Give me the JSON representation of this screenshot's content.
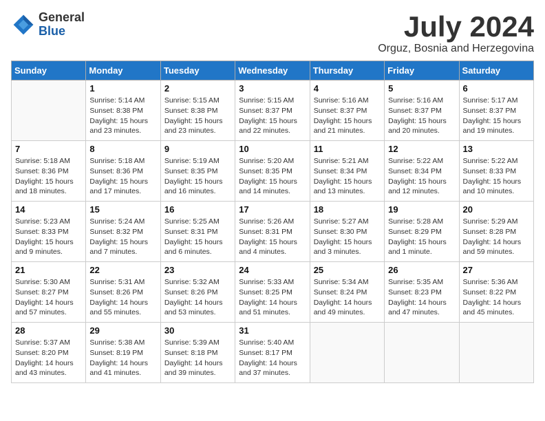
{
  "header": {
    "logo_general": "General",
    "logo_blue": "Blue",
    "month_title": "July 2024",
    "location": "Orguz, Bosnia and Herzegovina"
  },
  "days_of_week": [
    "Sunday",
    "Monday",
    "Tuesday",
    "Wednesday",
    "Thursday",
    "Friday",
    "Saturday"
  ],
  "weeks": [
    [
      {
        "day": "",
        "info": ""
      },
      {
        "day": "1",
        "info": "Sunrise: 5:14 AM\nSunset: 8:38 PM\nDaylight: 15 hours and 23 minutes."
      },
      {
        "day": "2",
        "info": "Sunrise: 5:15 AM\nSunset: 8:38 PM\nDaylight: 15 hours and 23 minutes."
      },
      {
        "day": "3",
        "info": "Sunrise: 5:15 AM\nSunset: 8:37 PM\nDaylight: 15 hours and 22 minutes."
      },
      {
        "day": "4",
        "info": "Sunrise: 5:16 AM\nSunset: 8:37 PM\nDaylight: 15 hours and 21 minutes."
      },
      {
        "day": "5",
        "info": "Sunrise: 5:16 AM\nSunset: 8:37 PM\nDaylight: 15 hours and 20 minutes."
      },
      {
        "day": "6",
        "info": "Sunrise: 5:17 AM\nSunset: 8:37 PM\nDaylight: 15 hours and 19 minutes."
      }
    ],
    [
      {
        "day": "7",
        "info": "Sunrise: 5:18 AM\nSunset: 8:36 PM\nDaylight: 15 hours and 18 minutes."
      },
      {
        "day": "8",
        "info": "Sunrise: 5:18 AM\nSunset: 8:36 PM\nDaylight: 15 hours and 17 minutes."
      },
      {
        "day": "9",
        "info": "Sunrise: 5:19 AM\nSunset: 8:35 PM\nDaylight: 15 hours and 16 minutes."
      },
      {
        "day": "10",
        "info": "Sunrise: 5:20 AM\nSunset: 8:35 PM\nDaylight: 15 hours and 14 minutes."
      },
      {
        "day": "11",
        "info": "Sunrise: 5:21 AM\nSunset: 8:34 PM\nDaylight: 15 hours and 13 minutes."
      },
      {
        "day": "12",
        "info": "Sunrise: 5:22 AM\nSunset: 8:34 PM\nDaylight: 15 hours and 12 minutes."
      },
      {
        "day": "13",
        "info": "Sunrise: 5:22 AM\nSunset: 8:33 PM\nDaylight: 15 hours and 10 minutes."
      }
    ],
    [
      {
        "day": "14",
        "info": "Sunrise: 5:23 AM\nSunset: 8:33 PM\nDaylight: 15 hours and 9 minutes."
      },
      {
        "day": "15",
        "info": "Sunrise: 5:24 AM\nSunset: 8:32 PM\nDaylight: 15 hours and 7 minutes."
      },
      {
        "day": "16",
        "info": "Sunrise: 5:25 AM\nSunset: 8:31 PM\nDaylight: 15 hours and 6 minutes."
      },
      {
        "day": "17",
        "info": "Sunrise: 5:26 AM\nSunset: 8:31 PM\nDaylight: 15 hours and 4 minutes."
      },
      {
        "day": "18",
        "info": "Sunrise: 5:27 AM\nSunset: 8:30 PM\nDaylight: 15 hours and 3 minutes."
      },
      {
        "day": "19",
        "info": "Sunrise: 5:28 AM\nSunset: 8:29 PM\nDaylight: 15 hours and 1 minute."
      },
      {
        "day": "20",
        "info": "Sunrise: 5:29 AM\nSunset: 8:28 PM\nDaylight: 14 hours and 59 minutes."
      }
    ],
    [
      {
        "day": "21",
        "info": "Sunrise: 5:30 AM\nSunset: 8:27 PM\nDaylight: 14 hours and 57 minutes."
      },
      {
        "day": "22",
        "info": "Sunrise: 5:31 AM\nSunset: 8:26 PM\nDaylight: 14 hours and 55 minutes."
      },
      {
        "day": "23",
        "info": "Sunrise: 5:32 AM\nSunset: 8:26 PM\nDaylight: 14 hours and 53 minutes."
      },
      {
        "day": "24",
        "info": "Sunrise: 5:33 AM\nSunset: 8:25 PM\nDaylight: 14 hours and 51 minutes."
      },
      {
        "day": "25",
        "info": "Sunrise: 5:34 AM\nSunset: 8:24 PM\nDaylight: 14 hours and 49 minutes."
      },
      {
        "day": "26",
        "info": "Sunrise: 5:35 AM\nSunset: 8:23 PM\nDaylight: 14 hours and 47 minutes."
      },
      {
        "day": "27",
        "info": "Sunrise: 5:36 AM\nSunset: 8:22 PM\nDaylight: 14 hours and 45 minutes."
      }
    ],
    [
      {
        "day": "28",
        "info": "Sunrise: 5:37 AM\nSunset: 8:20 PM\nDaylight: 14 hours and 43 minutes."
      },
      {
        "day": "29",
        "info": "Sunrise: 5:38 AM\nSunset: 8:19 PM\nDaylight: 14 hours and 41 minutes."
      },
      {
        "day": "30",
        "info": "Sunrise: 5:39 AM\nSunset: 8:18 PM\nDaylight: 14 hours and 39 minutes."
      },
      {
        "day": "31",
        "info": "Sunrise: 5:40 AM\nSunset: 8:17 PM\nDaylight: 14 hours and 37 minutes."
      },
      {
        "day": "",
        "info": ""
      },
      {
        "day": "",
        "info": ""
      },
      {
        "day": "",
        "info": ""
      }
    ]
  ]
}
